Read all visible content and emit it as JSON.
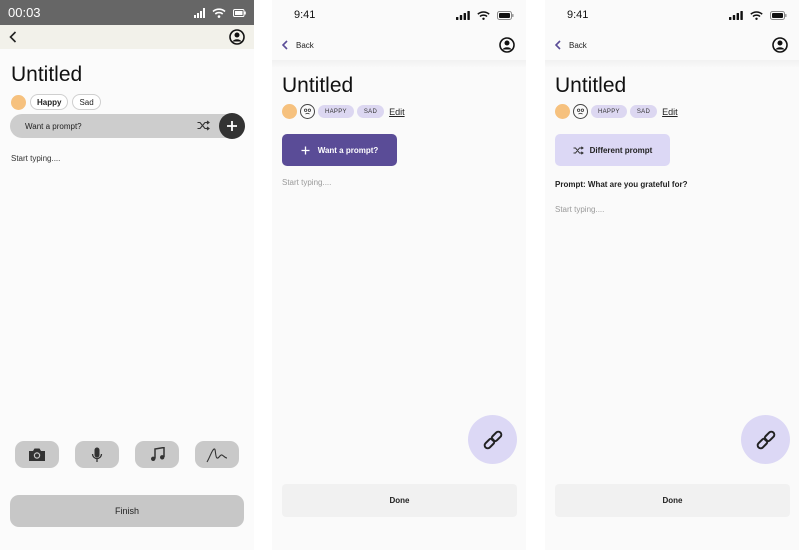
{
  "screen1": {
    "time": "00:03",
    "title": "Untitled",
    "moods": [
      "Happy",
      "Sad"
    ],
    "prompt_placeholder": "Want a prompt?",
    "typing_placeholder": "Start typing....",
    "finish_label": "Finish",
    "tools": [
      "camera-icon",
      "microphone-icon",
      "music-icon",
      "draw-icon"
    ]
  },
  "screen2": {
    "time": "9:41",
    "back_label": "Back",
    "title": "Untitled",
    "moods": [
      "HAPPY",
      "SAD"
    ],
    "edit_label": "Edit",
    "prompt_button_label": "Want a prompt?",
    "typing_placeholder": "Start typing....",
    "done_label": "Done"
  },
  "screen3": {
    "time": "9:41",
    "back_label": "Back",
    "title": "Untitled",
    "moods": [
      "HAPPY",
      "SAD"
    ],
    "edit_label": "Edit",
    "prompt_button_label": "Different prompt",
    "prompt_text": "Prompt: What are you grateful for?",
    "typing_placeholder": "Start typing....",
    "done_label": "Done"
  },
  "colors": {
    "accent": "#5a4c97",
    "accent_light": "#dcd8f5",
    "mood_happy": "#f6c17e"
  }
}
